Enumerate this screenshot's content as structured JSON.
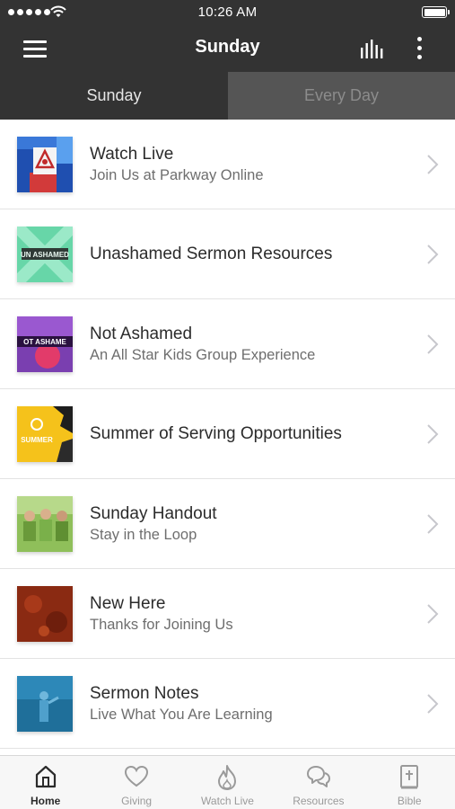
{
  "status_bar": {
    "time": "10:26 AM"
  },
  "nav": {
    "title": "Sunday",
    "menu_icon": "hamburger-menu-icon",
    "chart_icon": "bar-chart-icon",
    "more_icon": "more-vertical-icon"
  },
  "tabs": [
    {
      "label": "Sunday",
      "active": true
    },
    {
      "label": "Every Day",
      "active": false
    }
  ],
  "items": [
    {
      "title": "Watch Live",
      "subtitle": "Join Us at Parkway Online"
    },
    {
      "title": "Unashamed Sermon Resources",
      "subtitle": "",
      "thumb_text": "UN ASHAMED"
    },
    {
      "title": "Not Ashamed",
      "subtitle": "An All Star Kids Group Experience",
      "thumb_text": "OT ASHAME"
    },
    {
      "title": "Summer of Serving Opportunities",
      "subtitle": "",
      "thumb_text": "SUMMER"
    },
    {
      "title": "Sunday Handout",
      "subtitle": "Stay in the Loop"
    },
    {
      "title": "New Here",
      "subtitle": "Thanks for Joining Us"
    },
    {
      "title": "Sermon Notes",
      "subtitle": "Live What You Are Learning"
    }
  ],
  "tab_bar": [
    {
      "label": "Home",
      "icon": "home-icon",
      "active": true
    },
    {
      "label": "Giving",
      "icon": "heart-icon",
      "active": false
    },
    {
      "label": "Watch Live",
      "icon": "flame-icon",
      "active": false
    },
    {
      "label": "Resources",
      "icon": "chat-bubbles-icon",
      "active": false
    },
    {
      "label": "Bible",
      "icon": "bible-icon",
      "active": false
    }
  ],
  "colors": {
    "header_bg": "#333333",
    "inactive_tab_bg": "#555555",
    "tab_bar_bg": "#f7f7f7"
  }
}
